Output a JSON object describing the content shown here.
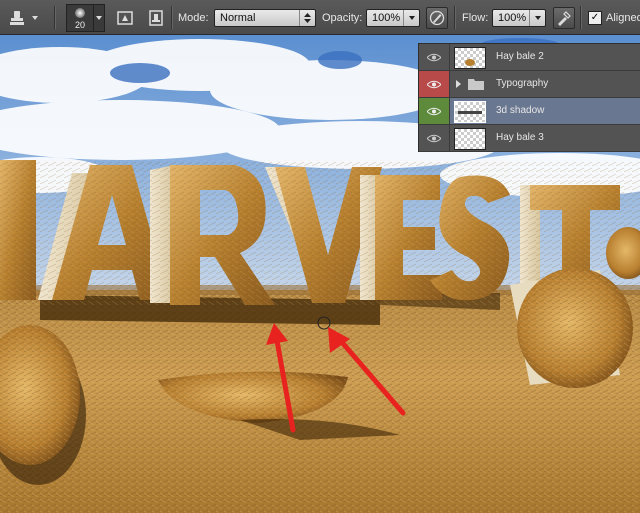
{
  "options_bar": {
    "brush_size": "20",
    "mode_label": "Mode:",
    "mode_value": "Normal",
    "opacity_label": "Opacity:",
    "opacity_value": "100%",
    "flow_label": "Flow:",
    "flow_value": "100%",
    "aligned_label": "Aligned",
    "aligned_checked": true
  },
  "layers": [
    {
      "name": "Hay bale 2",
      "eye_color": "#535353",
      "selected": false,
      "type": "layer"
    },
    {
      "name": "Typography",
      "eye_color": "#b94a4a",
      "selected": false,
      "type": "group"
    },
    {
      "name": "3d shadow",
      "eye_color": "#5e8a3c",
      "selected": true,
      "type": "layer"
    },
    {
      "name": "Hay bale 3",
      "eye_color": "#535353",
      "selected": false,
      "type": "layer"
    }
  ],
  "canvas": {
    "headline": "HARVEST",
    "sky_color": "#4f86c9",
    "hay_color": "#c8963e",
    "arrow_color": "#e8231f"
  }
}
